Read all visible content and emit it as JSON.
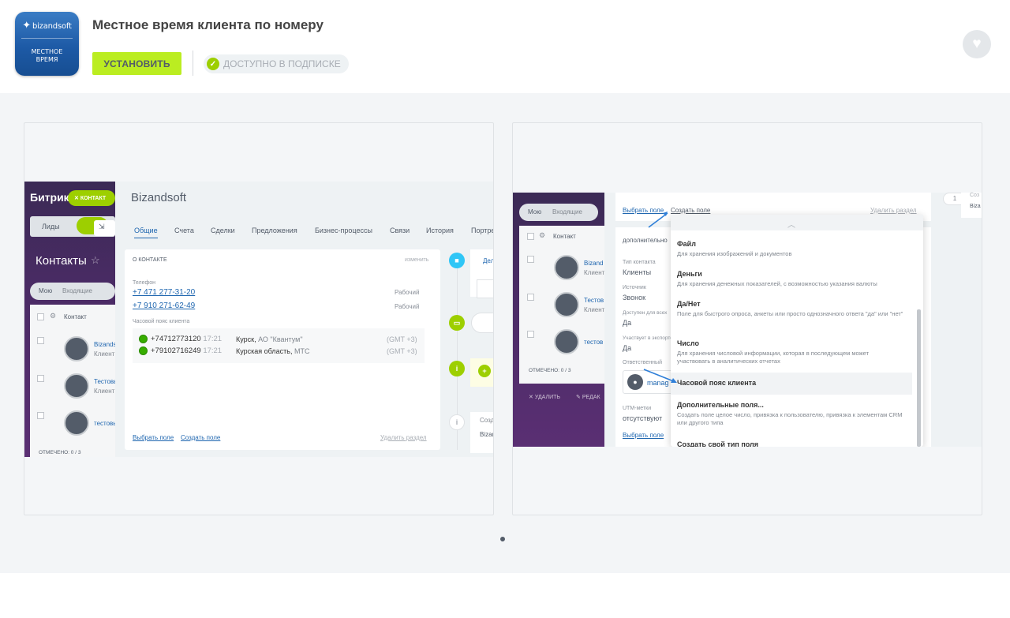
{
  "app": {
    "logo_brand": "bizandsoft",
    "logo_line1": "МЕСТНОЕ",
    "logo_line2": "ВРЕМЯ",
    "title": "Местное время клиента по номеру",
    "install_label": "УСТАНОВИТЬ",
    "subscription_label": "ДОСТУПНО В ПОДПИСКЕ"
  },
  "colors": {
    "install": "#bbed21",
    "check": "#9dcf00",
    "link": "#2067b0"
  },
  "slide1": {
    "bitrix": "Битрикс",
    "badge": "КОНТАКТ",
    "leads": "Лиды",
    "contacts": "Контакты",
    "filter": "Мою",
    "incoming": "Входящие",
    "contact_col": "Контакт",
    "marked": "ОТМЕЧЕНО: 0 / 3",
    "rows": [
      {
        "name": "Bizandsoft",
        "sub": "Клиент"
      },
      {
        "name": "Тестовый",
        "sub": "Клиент"
      },
      {
        "name": "тестовый",
        "sub": ""
      }
    ],
    "company": "Bizandsoft",
    "tabs": [
      "Общие",
      "Счета",
      "Сделки",
      "Предложения",
      "Бизнес-процессы",
      "Связи",
      "История",
      "Портрет"
    ],
    "section": "О КОНТАКТЕ",
    "change": "изменить",
    "phone_label": "Телефон",
    "phones": [
      {
        "num": "+7 471 277-31-20",
        "type": "Рабочий"
      },
      {
        "num": "+7 910 271-62-49",
        "type": "Рабочий"
      }
    ],
    "tz_label": "Часовой пояс клиента",
    "tz": [
      {
        "num": "+74712773120",
        "time": "17:21",
        "city": "Курск,",
        "op": "АО \"Квантум\"",
        "gmt": "(GMT +3)"
      },
      {
        "num": "+79102716249",
        "time": "17:21",
        "city": "Курская область,",
        "op": "МТС",
        "gmt": "(GMT +3)"
      }
    ],
    "select_field": "Выбрать поле",
    "create_field": "Создать поле",
    "delete_section": "Удалить раздел",
    "right_tab": "Дела",
    "right_create": "Создать",
    "right_biz": "Bizands"
  },
  "slide2": {
    "filter": "Мою",
    "incoming": "Входящие",
    "contact_col": "Контакт",
    "rows": [
      {
        "name": "Bizand",
        "sub": "Клиент"
      },
      {
        "name": "Тестов",
        "sub": "Клиент"
      },
      {
        "name": "тестов",
        "sub": ""
      }
    ],
    "marked": "ОТМЕЧЕНО: 0 / 3",
    "delete": "УДАЛИТЬ",
    "edit": "РЕДАК",
    "select_field": "Выбрать поле",
    "create_field": "Создать поле",
    "delete_section": "Удалить раздел",
    "section": "дополнительно",
    "fields": [
      {
        "label": "Тип контакта",
        "value": "Клиенты"
      },
      {
        "label": "Источник",
        "value": "Звонок"
      },
      {
        "label": "Доступен для всех",
        "value": "Да"
      },
      {
        "label": "Участвует в экспорте",
        "value": "Да"
      },
      {
        "label": "Ответственный",
        "value": "manag"
      },
      {
        "label": "UTM-метки",
        "value": "отсутствуют"
      }
    ],
    "select_field2": "Выбрать поле",
    "menu": [
      {
        "title": "Файл",
        "desc": "Для хранения изображений и документов"
      },
      {
        "title": "Деньги",
        "desc": "Для хранения денежных показателей, с возможностью указания валюты"
      },
      {
        "title": "Да/Нет",
        "desc": "Поле для быстрого опроса, анкеты или просто однозначного ответа \"да\" или \"нет\""
      },
      {
        "title": "Число",
        "desc": "Для хранения числовой информации, которая в последующем может участвовать в аналитических отчетах"
      },
      {
        "title": "Часовой пояс клиента",
        "desc": ""
      },
      {
        "title": "Дополнительные поля...",
        "desc": "Создать поле целое число, привязка к пользователю, привязка к элементам CRM или другого типа"
      },
      {
        "title": "Создать свой тип поля",
        "desc": ""
      }
    ],
    "side_num": "1",
    "side_c": "Соз",
    "side_b": "Biza"
  }
}
